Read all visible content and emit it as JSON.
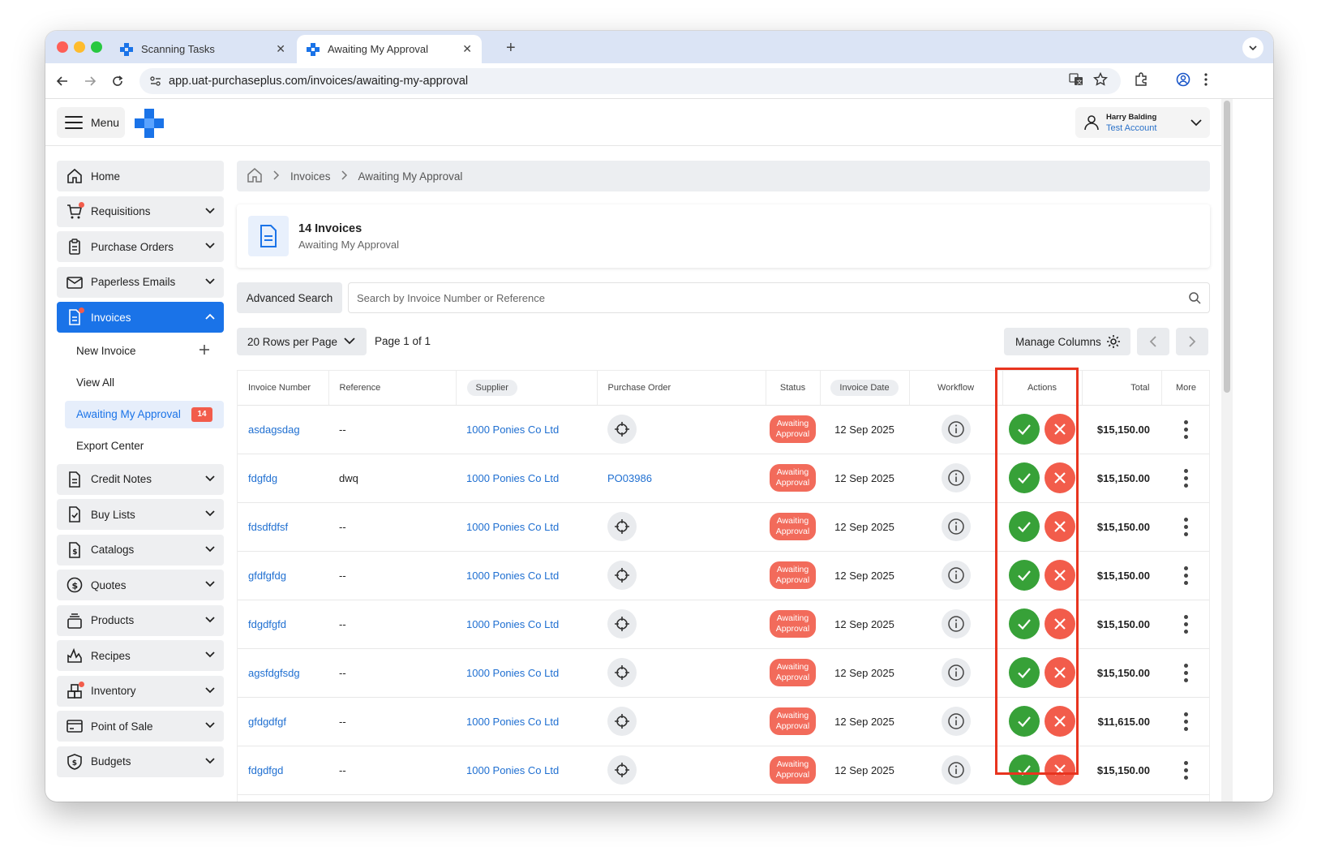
{
  "browser": {
    "tabs": [
      {
        "title": "Scanning Tasks",
        "active": false
      },
      {
        "title": "Awaiting My Approval",
        "active": true
      }
    ],
    "url_host": "app.uat-purchaseplus.com",
    "url_path": "/invoices/awaiting-my-approval"
  },
  "header": {
    "menu_label": "Menu",
    "user_name": "Harry Balding",
    "user_account": "Test Account"
  },
  "sidebar": {
    "items": [
      {
        "label": "Home",
        "icon": "home-icon"
      },
      {
        "label": "Requisitions",
        "icon": "cart-icon"
      },
      {
        "label": "Purchase Orders",
        "icon": "clipboard-icon"
      },
      {
        "label": "Paperless Emails",
        "icon": "mail-icon"
      },
      {
        "label": "Invoices",
        "icon": "invoice-icon"
      },
      {
        "label": "Credit Notes",
        "icon": "document-icon"
      },
      {
        "label": "Buy Lists",
        "icon": "checklist-icon"
      },
      {
        "label": "Catalogs",
        "icon": "catalog-icon"
      },
      {
        "label": "Quotes",
        "icon": "dollar-icon"
      },
      {
        "label": "Products",
        "icon": "products-icon"
      },
      {
        "label": "Recipes",
        "icon": "flame-icon"
      },
      {
        "label": "Inventory",
        "icon": "inventory-icon"
      },
      {
        "label": "Point of Sale",
        "icon": "card-icon"
      },
      {
        "label": "Budgets",
        "icon": "shield-dollar-icon"
      }
    ],
    "invoice_sub": {
      "new_invoice": "New Invoice",
      "view_all": "View All",
      "awaiting": "Awaiting My Approval",
      "awaiting_count": "14",
      "export_center": "Export Center"
    }
  },
  "breadcrumb": {
    "level1": "Invoices",
    "level2": "Awaiting My Approval"
  },
  "title_card": {
    "title": "14 Invoices",
    "subtitle": "Awaiting My Approval"
  },
  "search": {
    "advanced_label": "Advanced Search",
    "placeholder": "Search by Invoice Number or Reference"
  },
  "pagination": {
    "rows_label": "20 Rows per Page",
    "page_info": "Page 1 of 1",
    "manage_columns": "Manage Columns"
  },
  "table": {
    "headers": {
      "invoice_number": "Invoice Number",
      "reference": "Reference",
      "supplier": "Supplier",
      "purchase_order": "Purchase Order",
      "status": "Status",
      "invoice_date": "Invoice Date",
      "workflow": "Workflow",
      "actions": "Actions",
      "total": "Total",
      "more": "More"
    },
    "rows": [
      {
        "invoice": "asdagsdag",
        "reference": "--",
        "supplier": "1000 Ponies Co Ltd",
        "po": "",
        "status_l1": "Awaiting",
        "status_l2": "Approval",
        "date": "12 Sep 2025",
        "total": "$15,150.00"
      },
      {
        "invoice": "fdgfdg",
        "reference": "dwq",
        "supplier": "1000 Ponies Co Ltd",
        "po": "PO03986",
        "status_l1": "Awaiting",
        "status_l2": "Approval",
        "date": "12 Sep 2025",
        "total": "$15,150.00"
      },
      {
        "invoice": "fdsdfdfsf",
        "reference": "--",
        "supplier": "1000 Ponies Co Ltd",
        "po": "",
        "status_l1": "Awaiting",
        "status_l2": "Approval",
        "date": "12 Sep 2025",
        "total": "$15,150.00"
      },
      {
        "invoice": "gfdfgfdg",
        "reference": "--",
        "supplier": "1000 Ponies Co Ltd",
        "po": "",
        "status_l1": "Awaiting",
        "status_l2": "Approval",
        "date": "12 Sep 2025",
        "total": "$15,150.00"
      },
      {
        "invoice": "fdgdfgfd",
        "reference": "--",
        "supplier": "1000 Ponies Co Ltd",
        "po": "",
        "status_l1": "Awaiting",
        "status_l2": "Approval",
        "date": "12 Sep 2025",
        "total": "$15,150.00"
      },
      {
        "invoice": "agsfdgfsdg",
        "reference": "--",
        "supplier": "1000 Ponies Co Ltd",
        "po": "",
        "status_l1": "Awaiting",
        "status_l2": "Approval",
        "date": "12 Sep 2025",
        "total": "$15,150.00"
      },
      {
        "invoice": "gfdgdfgf",
        "reference": "--",
        "supplier": "1000 Ponies Co Ltd",
        "po": "",
        "status_l1": "Awaiting",
        "status_l2": "Approval",
        "date": "12 Sep 2025",
        "total": "$11,615.00"
      },
      {
        "invoice": "fdgdfgd",
        "reference": "--",
        "supplier": "1000 Ponies Co Ltd",
        "po": "",
        "status_l1": "Awaiting",
        "status_l2": "Approval",
        "date": "12 Sep 2025",
        "total": "$15,150.00"
      }
    ]
  },
  "colors": {
    "primary": "#1a73e8",
    "approve": "#37a138",
    "reject": "#f25c4b",
    "status": "#f26b5b",
    "highlight": "#e8341f"
  }
}
